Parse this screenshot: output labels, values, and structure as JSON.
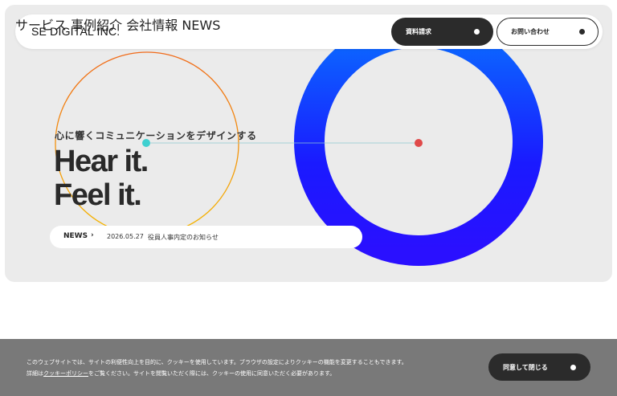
{
  "header": {
    "logo": "SE DIGITAL INC.",
    "nav": [
      {
        "label": "サービス"
      },
      {
        "label": "事例紹介"
      },
      {
        "label": "会社情報"
      },
      {
        "label": "NEWS"
      }
    ],
    "request_button": "資料請求",
    "contact_button": "お問い合わせ"
  },
  "hero": {
    "tagline": "心に響くコミュニケーションをデザインする",
    "headline_1": "Hear it.",
    "headline_2": "Feel it."
  },
  "news": {
    "tag": "NEWS",
    "arrow": "›",
    "date": "2026.05.27",
    "title": "役員人事内定のお知らせ"
  },
  "cookie": {
    "line1": "このウェブサイトでは、サイトの利便性向上を目的に、クッキーを使用しています。ブラウザの設定によりクッキーの機能を変更することもできます。",
    "line2_prefix": "詳細は",
    "line2_link": "クッキーポリシー",
    "line2_suffix": "をご覧ください。サイトを閲覧いただく際には、クッキーの使用に同意いただく必要があります。",
    "agree_button": "同意して閉じる"
  },
  "colors": {
    "ring_blue": "#1a1aff",
    "ring_blue_light": "#0a6cff",
    "orange_circle_top": "#f06a1a",
    "orange_circle_bottom": "#f5b800",
    "teal_dot": "#3fd0d0",
    "red_dot": "#e04a4a",
    "dark_button": "#2b2b2b"
  }
}
